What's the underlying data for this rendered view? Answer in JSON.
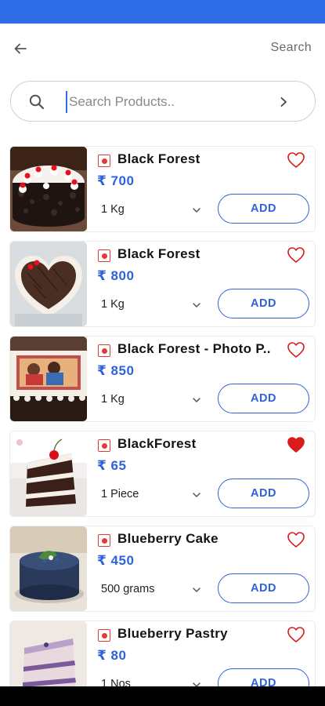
{
  "header": {
    "back_icon": "arrow-left-icon",
    "title": "Search"
  },
  "search": {
    "placeholder": "Search Products..",
    "value": "",
    "icon": "search-icon",
    "go_icon": "chevron-right-icon"
  },
  "colors": {
    "accent": "#2f62d8",
    "status_bar": "#2f6de6",
    "veg_mark": "#e53935",
    "heart_active": "#d81b1b"
  },
  "products": [
    {
      "name": "Black Forest",
      "price": "₹ 700",
      "quantity": "1 Kg",
      "add_label": "ADD",
      "favorite": false,
      "image": "black-forest-round-cake"
    },
    {
      "name": "Black Forest",
      "price": "₹ 800",
      "quantity": "1 Kg",
      "add_label": "ADD",
      "favorite": false,
      "image": "black-forest-heart-cake"
    },
    {
      "name": "Black Forest - Photo P..",
      "price": "₹ 850",
      "quantity": "1 Kg",
      "add_label": "ADD",
      "favorite": false,
      "image": "black-forest-photo-cake"
    },
    {
      "name": "BlackForest",
      "price": "₹ 65",
      "quantity": "1 Piece",
      "add_label": "ADD",
      "favorite": true,
      "image": "black-forest-pastry-slice"
    },
    {
      "name": "Blueberry Cake",
      "price": "₹ 450",
      "quantity": "500 grams",
      "add_label": "ADD",
      "favorite": false,
      "image": "blueberry-cake"
    },
    {
      "name": "Blueberry Pastry",
      "price": "₹ 80",
      "quantity": "1 Nos",
      "add_label": "ADD",
      "favorite": false,
      "image": "blueberry-pastry-slice"
    }
  ]
}
